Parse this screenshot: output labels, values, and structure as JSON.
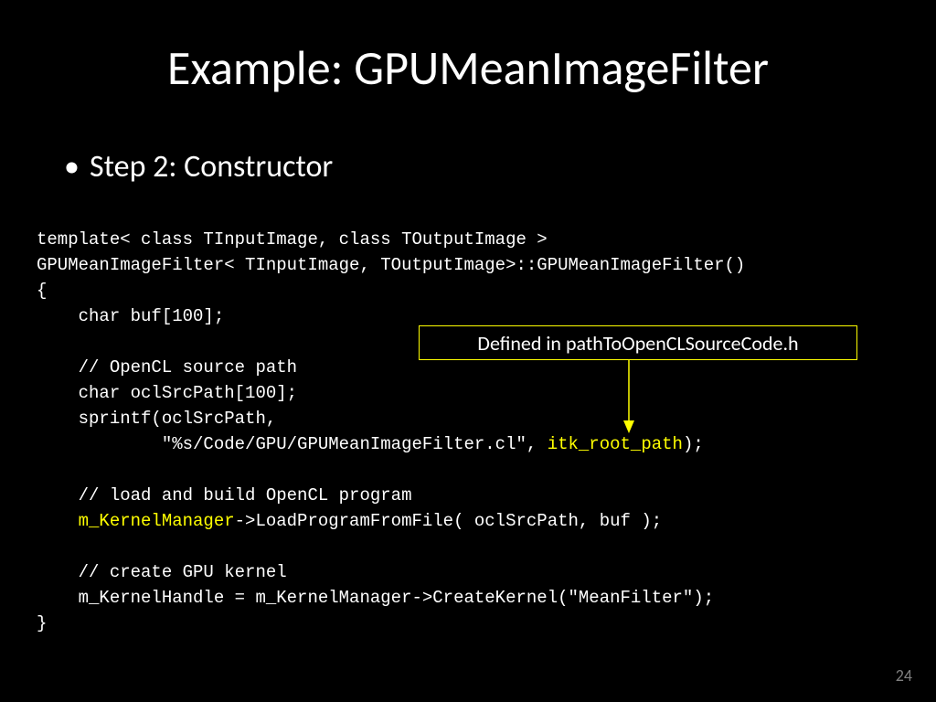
{
  "title": "Example: GPUMeanImageFilter",
  "bullet": "Step 2: Constructor",
  "code": {
    "l1": "template< class TInputImage, class TOutputImage >",
    "l2": "GPUMeanImageFilter< TInputImage, TOutputImage>::GPUMeanImageFilter()",
    "l3": "{",
    "l4": "    char buf[100];",
    "l5": "",
    "l6": "    // OpenCL source path",
    "l7": "    char oclSrcPath[100];",
    "l8": "    sprintf(oclSrcPath,",
    "l9a": "            \"%s/Code/GPU/GPUMeanImageFilter.cl\", ",
    "l9b": "itk_root_path",
    "l9c": ");",
    "l10": "",
    "l11": "    // load and build OpenCL program",
    "l12a": "    ",
    "l12b": "m_KernelManager",
    "l12c": "->LoadProgramFromFile( oclSrcPath, buf );",
    "l13": "",
    "l14": "    // create GPU kernel",
    "l15": "    m_KernelHandle = m_KernelManager->CreateKernel(\"MeanFilter\");",
    "l16": "}"
  },
  "callout": "Defined in pathToOpenCLSourceCode.h",
  "page_number": "24",
  "colors": {
    "highlight": "#ffff00",
    "background": "#000000",
    "text": "#ffffff"
  }
}
